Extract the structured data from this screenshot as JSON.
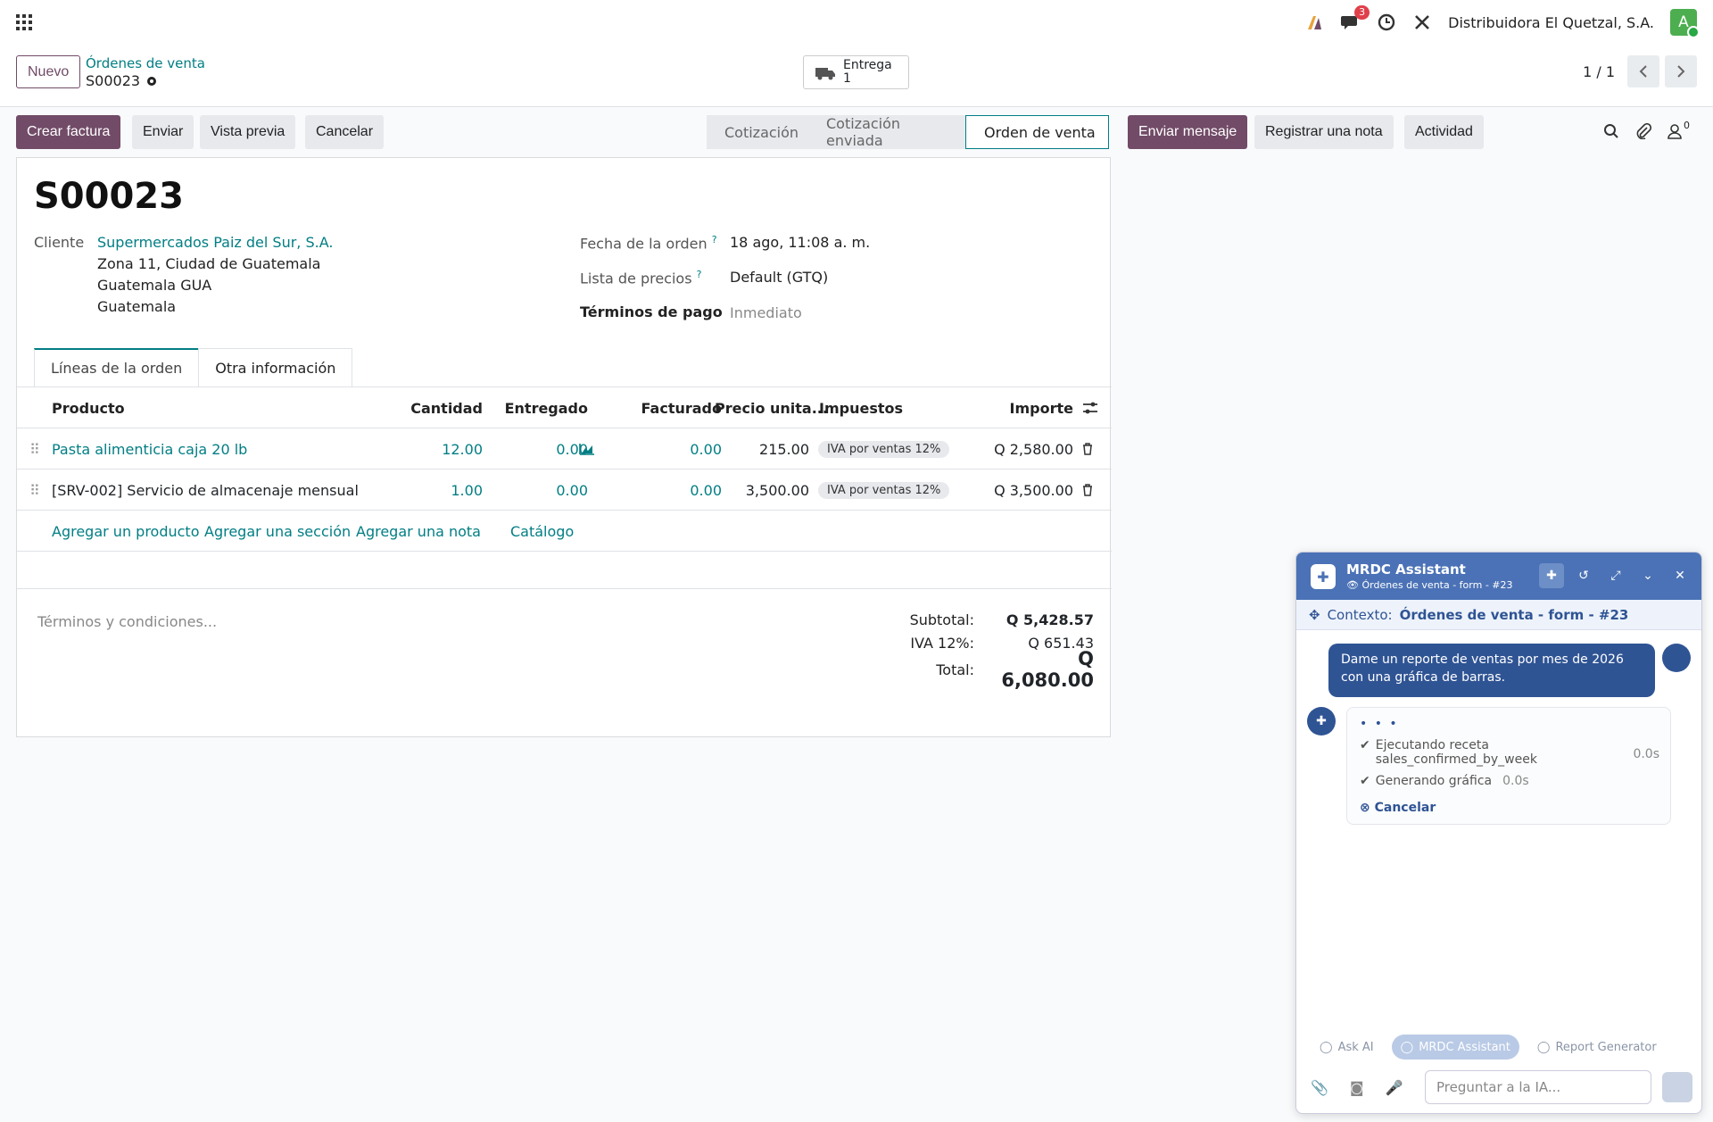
{
  "nav": {
    "company": "Distribuidora El Quetzal, S.A.",
    "messages_count": "3",
    "avatar_letter": "A"
  },
  "control": {
    "new_label": "Nuevo",
    "breadcrumb": "Órdenes de venta",
    "record": "S00023",
    "smart_label": "Entrega",
    "smart_count": "1",
    "pager": "1 / 1"
  },
  "buttons": {
    "create_invoice": "Crear factura",
    "send": "Enviar",
    "preview": "Vista previa",
    "cancel": "Cancelar",
    "send_message": "Enviar mensaje",
    "log_note": "Registrar una nota",
    "activity": "Actividad"
  },
  "followers_count": "0",
  "status": [
    "Cotización",
    "Cotización enviada",
    "Orden de venta"
  ],
  "form": {
    "title": "S00023",
    "customer_label": "Cliente",
    "customer": "Supermercados Paiz del Sur, S.A.",
    "addr1": "Zona 11, Ciudad de Guatemala",
    "addr2": "Guatemala GUA",
    "addr3": "Guatemala",
    "date_label": "Fecha de la orden",
    "date_value": "18 ago, 11:08 a. m.",
    "pricelist_label": "Lista de precios",
    "pricelist_value": "Default (GTQ)",
    "terms_label": "Términos de pago",
    "terms_value": "Inmediato"
  },
  "tabs": [
    "Líneas de la orden",
    "Otra información"
  ],
  "table": {
    "headers": {
      "product": "Producto",
      "qty": "Cantidad",
      "delivered": "Entregado",
      "invoiced": "Facturado",
      "price": "Precio unita...",
      "taxes": "Impuestos",
      "amount": "Importe"
    },
    "rows": [
      {
        "product": "Pasta alimenticia caja 20 lb",
        "qty": "12.00",
        "delivered": "0.00",
        "invoiced": "0.00",
        "price": "215.00",
        "tax": "IVA por ventas 12%",
        "amount": "Q 2,580.00"
      },
      {
        "product": "[SRV-002] Servicio de almacenaje mensual",
        "qty": "1.00",
        "delivered": "0.00",
        "invoiced": "0.00",
        "price": "3,500.00",
        "tax": "IVA por ventas 12%",
        "amount": "Q 3,500.00"
      }
    ],
    "actions": [
      "Agregar un producto",
      "Agregar una sección",
      "Agregar una nota",
      "Catálogo"
    ]
  },
  "terms_placeholder": "Términos y condiciones...",
  "totals": {
    "subtotal_label": "Subtotal:",
    "subtotal": "Q 5,428.57",
    "tax_label": "IVA 12%:",
    "tax": "Q 651.43",
    "total_label": "Total:",
    "total": "Q 6,080.00"
  },
  "chat": {
    "title": "MRDC Assistant",
    "subtitle": "Órdenes de venta - form - #23",
    "context_label": "Contexto:",
    "context_value": "Órdenes de venta - form - #23",
    "user_message": "Dame un reporte de ventas por mes de 2026 con una gráfica de barras.",
    "step1": "Ejecutando receta",
    "step1b": "sales_confirmed_by_week",
    "step1_time": "0.0s",
    "step2": "Generando gráfica",
    "step2_time": "0.0s",
    "cancel": "Cancelar",
    "modes": [
      "Ask AI",
      "MRDC Assistant",
      "Report Generator"
    ],
    "input_placeholder": "Preguntar a la IA..."
  }
}
